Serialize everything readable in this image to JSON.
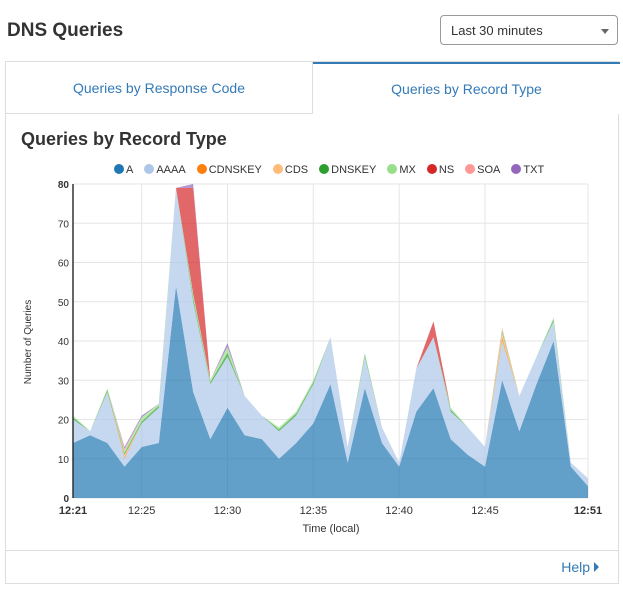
{
  "header": {
    "title": "DNS Queries",
    "time_range": {
      "selected": "Last 30 minutes"
    }
  },
  "tabs": [
    {
      "label": "Queries by Response Code",
      "active": false
    },
    {
      "label": "Queries by Record Type",
      "active": true
    }
  ],
  "footer": {
    "help_label": "Help"
  },
  "colors": {
    "accent": "#337ab7"
  },
  "chart_data": {
    "type": "area",
    "stacked": true,
    "title": "Queries by Record Type",
    "xlabel": "Time (local)",
    "ylabel": "Number of Queries",
    "ylim": [
      0,
      80
    ],
    "yticks": [
      0,
      10,
      20,
      30,
      40,
      50,
      60,
      70,
      80
    ],
    "xticks": [
      "12:21",
      "12:25",
      "12:30",
      "12:35",
      "12:40",
      "12:45",
      "12:51"
    ],
    "xticks_minutes": [
      0,
      4,
      9,
      14,
      19,
      24,
      30
    ],
    "grid": true,
    "legend_position": "top",
    "x": [
      "12:21",
      "12:22",
      "12:23",
      "12:24",
      "12:25",
      "12:26",
      "12:27",
      "12:28",
      "12:29",
      "12:30",
      "12:31",
      "12:32",
      "12:33",
      "12:34",
      "12:35",
      "12:36",
      "12:37",
      "12:38",
      "12:39",
      "12:40",
      "12:41",
      "12:42",
      "12:43",
      "12:44",
      "12:45",
      "12:46",
      "12:47",
      "12:48",
      "12:49",
      "12:50",
      "12:51"
    ],
    "series": [
      {
        "name": "A",
        "color": "#1f77b4",
        "values": [
          14,
          16,
          14,
          8,
          13,
          14,
          54,
          27,
          15,
          23,
          16,
          15,
          10,
          14,
          19,
          29,
          9,
          28,
          14,
          8,
          22,
          28,
          15,
          11,
          8,
          30,
          17,
          29,
          40,
          8,
          3
        ]
      },
      {
        "name": "AAAA",
        "color": "#aec7e8",
        "values": [
          6,
          1,
          13,
          2,
          6,
          9,
          25,
          23,
          14,
          13,
          10,
          6,
          7,
          7,
          10,
          12,
          4,
          8,
          4,
          1,
          11,
          13,
          7,
          7,
          5,
          10,
          9,
          7,
          5,
          1,
          2
        ]
      },
      {
        "name": "CDNSKEY",
        "color": "#ff7f0e",
        "values": [
          0,
          0,
          0,
          0.5,
          0,
          0,
          0,
          0,
          0,
          0,
          0,
          0,
          0,
          0,
          0,
          0,
          0,
          0,
          0,
          0,
          0,
          0,
          0,
          0,
          0,
          1,
          0,
          0,
          0,
          0,
          0
        ]
      },
      {
        "name": "CDS",
        "color": "#ffbb78",
        "values": [
          0,
          0,
          0,
          0.5,
          0,
          0,
          0,
          0,
          0,
          0,
          0,
          0,
          0,
          0,
          0,
          0,
          0,
          0,
          0,
          0,
          0,
          0,
          0,
          0,
          0,
          1,
          0,
          0,
          0,
          0,
          0
        ]
      },
      {
        "name": "DNSKEY",
        "color": "#2ca02c",
        "values": [
          0.5,
          0,
          0.5,
          0.5,
          0.5,
          0.5,
          0,
          1,
          0.5,
          1,
          0,
          0,
          0.5,
          0.5,
          0.5,
          0,
          0,
          0.5,
          0,
          0,
          0,
          0,
          0.5,
          0,
          0,
          0.5,
          0,
          0,
          0.5,
          0,
          0
        ]
      },
      {
        "name": "MX",
        "color": "#98df8a",
        "values": [
          0.5,
          0,
          0.5,
          0.5,
          1,
          0.5,
          0,
          1,
          0.5,
          1.5,
          0,
          0,
          0.5,
          0.5,
          0.5,
          0,
          0,
          0.5,
          0,
          0,
          0,
          0,
          0.5,
          0,
          0,
          0.5,
          0,
          0,
          0.5,
          0,
          0
        ]
      },
      {
        "name": "NS",
        "color": "#d62728",
        "values": [
          0,
          0,
          0,
          0,
          0,
          0,
          0,
          27,
          0,
          0,
          0,
          0,
          0,
          0,
          0,
          0,
          0,
          0,
          0,
          0,
          0,
          4,
          0,
          0,
          0,
          0,
          0,
          0,
          0,
          0,
          0
        ]
      },
      {
        "name": "SOA",
        "color": "#ff9896",
        "values": [
          0,
          0,
          0,
          0.5,
          0,
          0,
          0,
          0,
          0,
          0,
          0,
          0,
          0,
          0,
          0,
          0,
          0,
          0,
          0,
          0,
          0,
          0,
          0,
          0,
          0,
          0.5,
          0,
          0,
          0,
          0,
          0
        ]
      },
      {
        "name": "TXT",
        "color": "#9467bd",
        "values": [
          0,
          0,
          0,
          0.5,
          0.5,
          0,
          0,
          1,
          0,
          1,
          0,
          0,
          0,
          0,
          0,
          0,
          0,
          0,
          0,
          0,
          0,
          0,
          0,
          0,
          0,
          0,
          0,
          0,
          0,
          0,
          0
        ]
      }
    ]
  }
}
